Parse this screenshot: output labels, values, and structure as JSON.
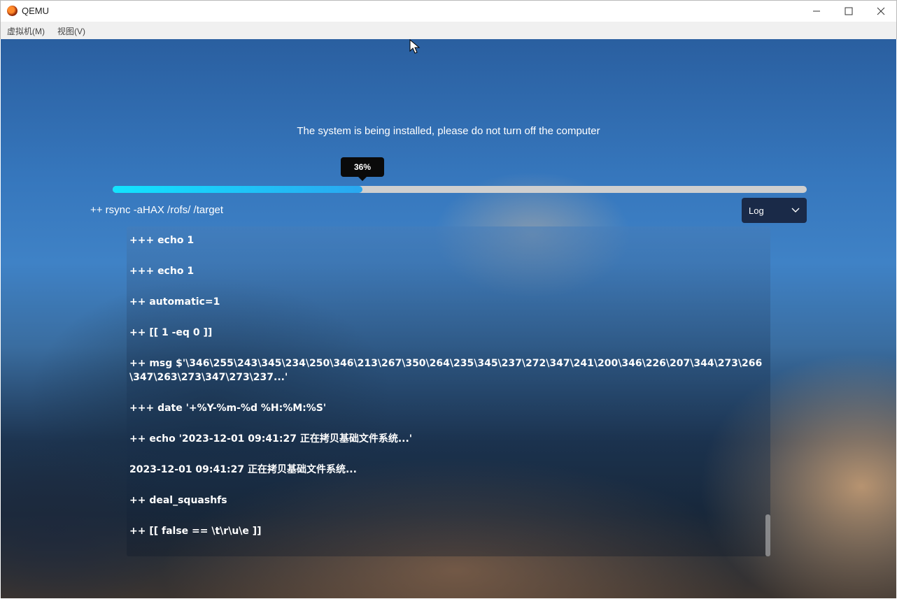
{
  "window": {
    "title": "QEMU",
    "minimize_glyph": "—",
    "maximize_glyph": "☐",
    "close_glyph": "✕"
  },
  "menubar": {
    "items": [
      {
        "label": "虚拟机(M)"
      },
      {
        "label": "视图(V)"
      }
    ]
  },
  "installer": {
    "message": "The system is being installed, please do not turn off the computer",
    "progress": {
      "percent": 36,
      "label": "36%"
    },
    "current_command": "++ rsync -aHAX /rofs/ /target",
    "view_select": {
      "value": "Log"
    },
    "log_lines": [
      "+++ echo 1",
      "+++ echo 1",
      "++ automatic=1",
      "++ [[ 1 -eq 0 ]]",
      "++ msg $'\\346\\255\\243\\345\\234\\250\\346\\213\\267\\350\\264\\235\\345\\237\\272\\347\\241\\200\\346\\226\\207\\344\\273\\266\\347\\263\\273\\347\\273\\237...'",
      "+++ date '+%Y-%m-%d %H:%M:%S'",
      "++ echo '2023-12-01 09:41:27 正在拷贝基础文件系统...'",
      "2023-12-01 09:41:27 正在拷贝基础文件系统...",
      "++ deal_squashfs",
      "++ [[ false == \\t\\r\\u\\e ]]"
    ]
  },
  "colors": {
    "progress_start": "#12e4ff",
    "progress_end": "#2aa7f0",
    "select_bg": "#1a2a48"
  }
}
